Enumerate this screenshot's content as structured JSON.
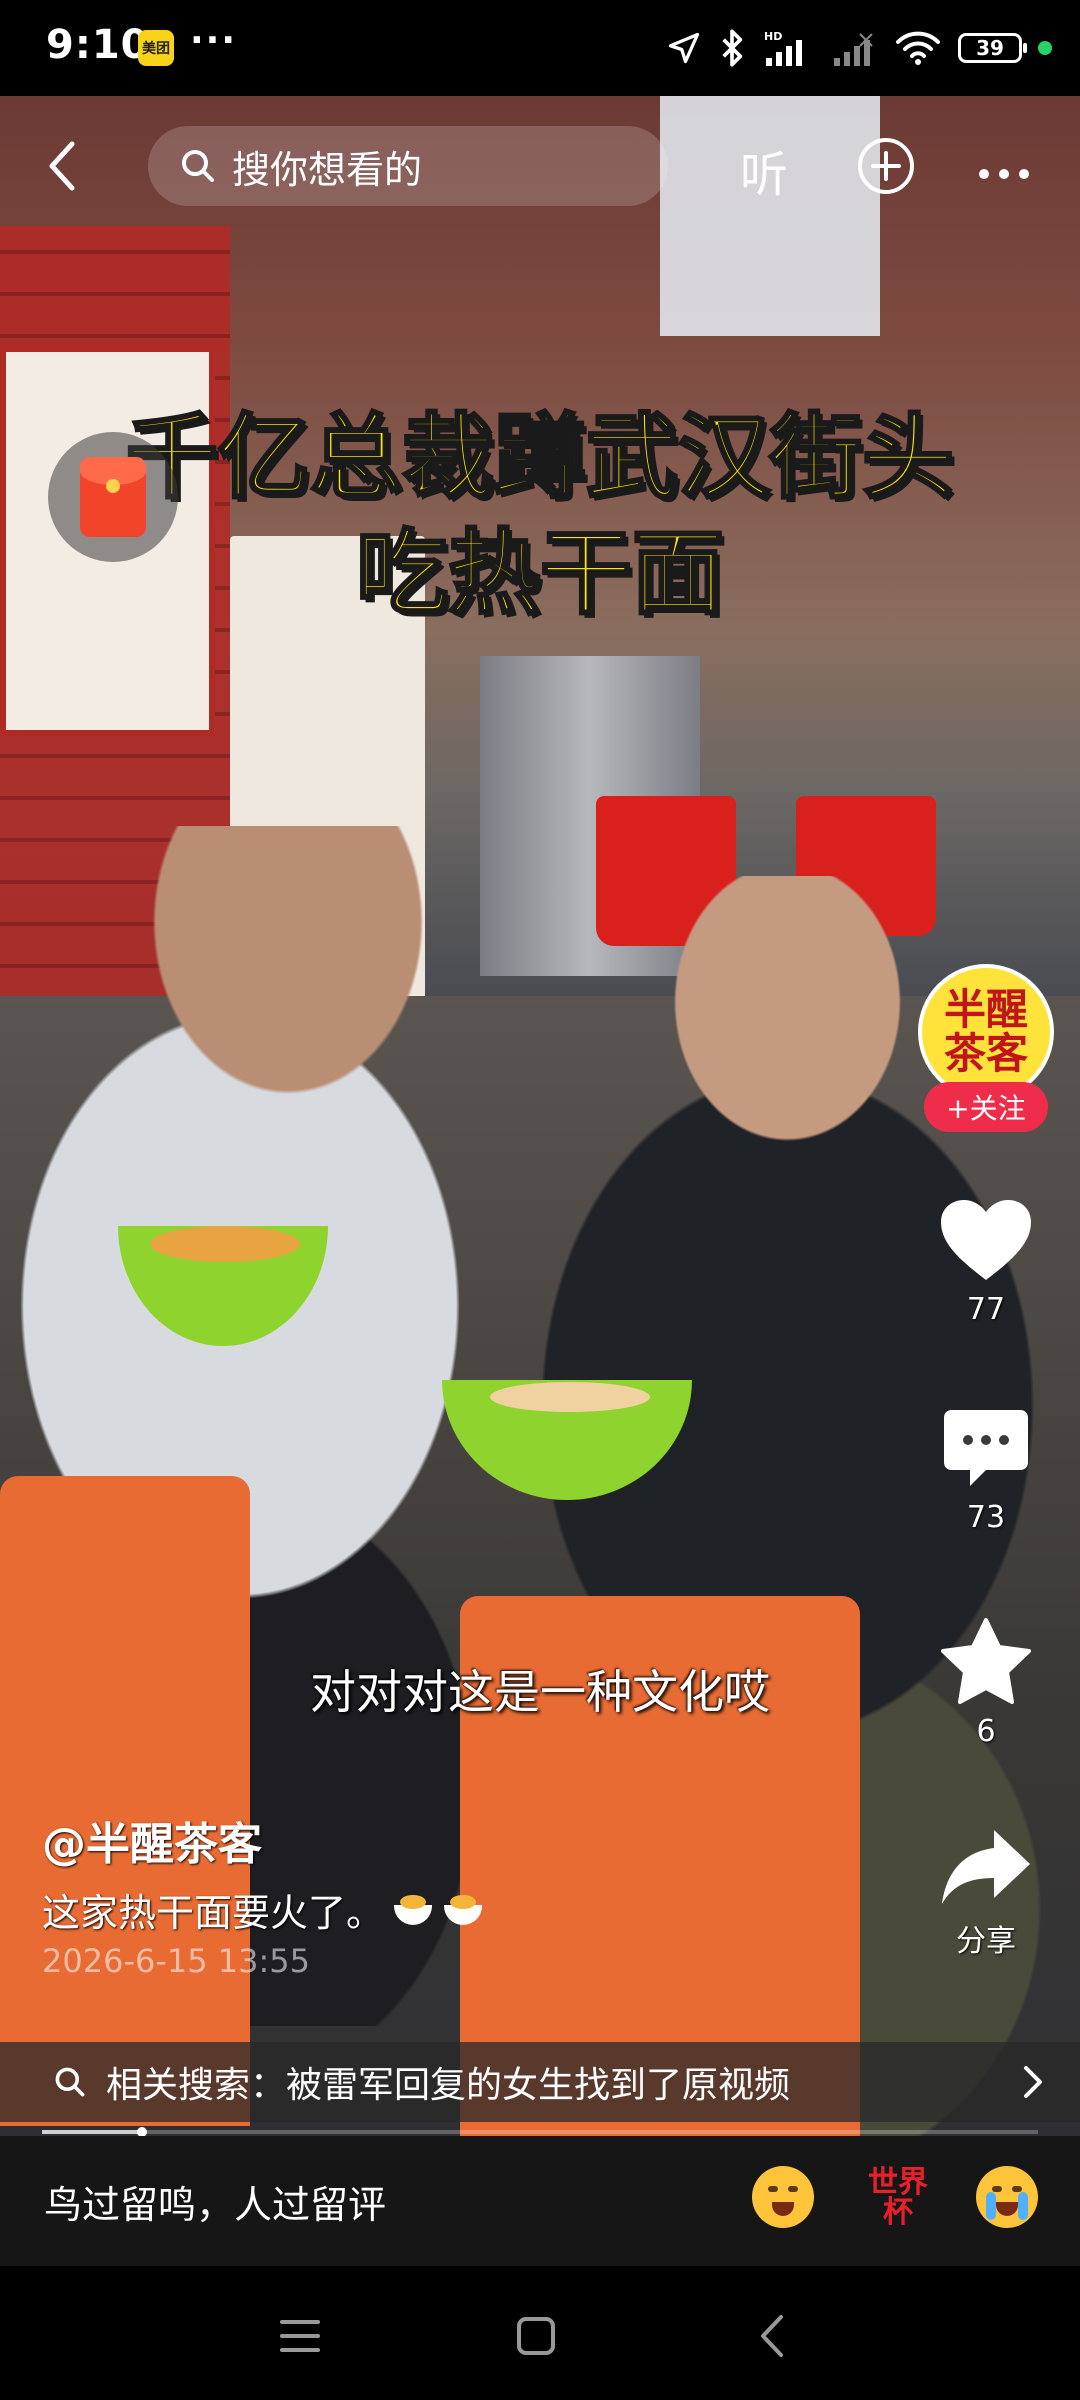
{
  "status_bar": {
    "time": "9:10",
    "app_badge": "美团",
    "dots": "···",
    "battery": "39"
  },
  "top_nav": {
    "search_placeholder": "搜你想看的",
    "listen_label": "听"
  },
  "video": {
    "headline_line1": "千亿总裁蹲武汉街头",
    "headline_line2": "吃热干面",
    "subtitle": "对对对这是一种文化哎"
  },
  "creator": {
    "avatar_line1": "半醒",
    "avatar_line2": "茶客",
    "follow_label": "+关注"
  },
  "actions": {
    "likes": "77",
    "comments": "73",
    "favorites": "6",
    "share_label": "分享"
  },
  "caption": {
    "author": "@半醒茶客",
    "description": "这家热干面要火了。",
    "timestamp": "2026-6-15 13:55"
  },
  "related_search": {
    "label": "相关搜索：被雷军回复的女生找到了原视频"
  },
  "playback": {
    "progress_fraction": 0.1
  },
  "comment_bar": {
    "placeholder": "鸟过留鸣，人过留评",
    "worldcup_line1": "世界",
    "worldcup_line2": "杯"
  },
  "colors": {
    "headline": "#ffe400",
    "follow_button": "#ef2d4b",
    "status_dot": "#25d366"
  }
}
